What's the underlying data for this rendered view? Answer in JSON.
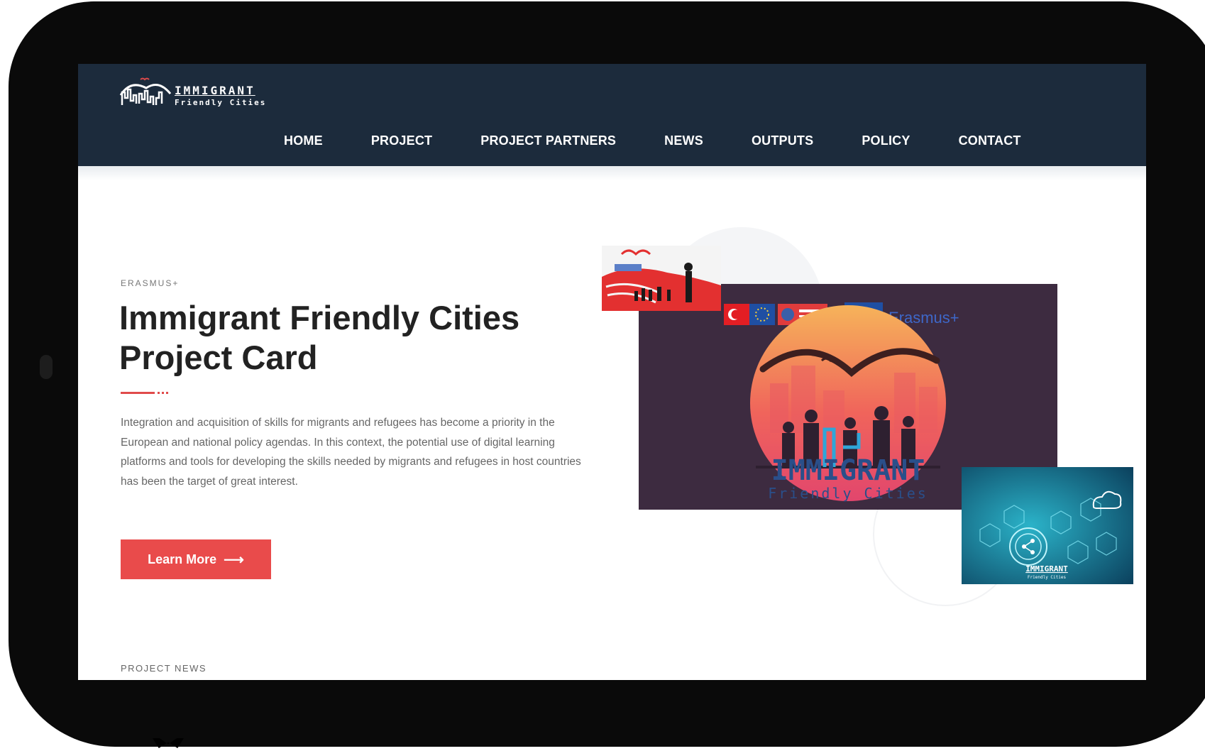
{
  "logo": {
    "title": "IMMIGRANT",
    "subtitle": "Friendly Cities"
  },
  "nav": {
    "items": [
      "HOME",
      "PROJECT",
      "PROJECT PARTNERS",
      "NEWS",
      "OUTPUTS",
      "POLICY",
      "CONTACT"
    ]
  },
  "hero": {
    "eyebrow": "ERASMUS+",
    "title": "Immigrant Friendly Cities Project Card",
    "description": "Integration and acquisition of skills for migrants and refugees has become a priority in the European and national policy agendas. In this context, the potential use of digital learning platforms and tools for developing the skills needed by migrants and refugees in host countries has been the target of great interest.",
    "button_label": "Learn More",
    "button_icon": "arrow-right-icon"
  },
  "main_image": {
    "badge_text": "Erasmus+",
    "title": "IMMIGRANT",
    "subtitle": "Friendly Cities"
  },
  "tech_image": {
    "title": "IMMIGRANT",
    "subtitle": "Friendly Cities"
  },
  "sections": {
    "next_label": "PROJECT NEWS"
  },
  "colors": {
    "nav_bg": "#1c2b3c",
    "accent": "#e94b4b",
    "poster_bg": "#3d2b40",
    "text_dark": "#222222"
  }
}
